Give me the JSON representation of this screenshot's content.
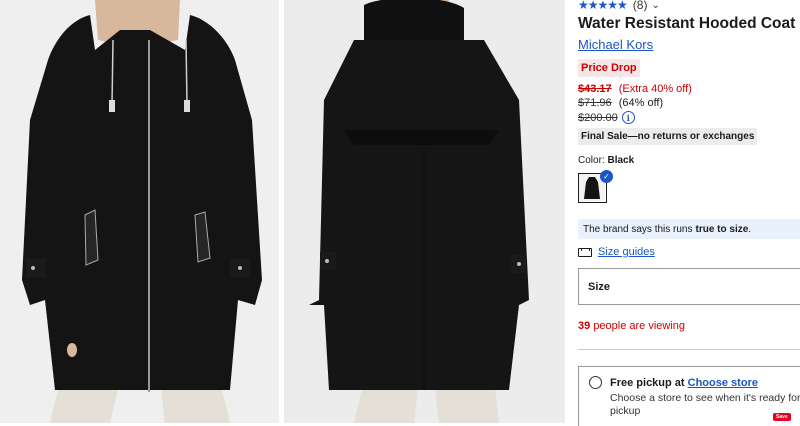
{
  "product": {
    "rating_count": "(8)",
    "title": "Water Resistant Hooded Coat",
    "brand": "Michael Kors",
    "badge": "Price Drop",
    "sale_price": "$43.17",
    "extra_off": "(Extra 40% off)",
    "was_price": "$71.96",
    "was_off": "(64% off)",
    "original_price": "$200.00",
    "final_sale": "Final Sale—no returns or exchanges",
    "color_label": "Color:",
    "color_value": "Black",
    "fit_text": "The brand says this runs",
    "fit_emphasis": "true to size",
    "fit_period": ".",
    "size_guides": "Size guides",
    "size_label": "Size",
    "viewing_count": "39",
    "viewing_text": "people are viewing",
    "pickup_title": "Free pickup at",
    "pickup_link": "Choose store",
    "pickup_desc": "Choose a store to see when it's ready for pickup",
    "pin_button": "Save"
  },
  "icons": {
    "stars": "★★★★★",
    "chevron": "⌄",
    "info": "i",
    "check": "✓"
  },
  "colors": {
    "accent": "#1a56c8",
    "sale": "#d10000"
  }
}
